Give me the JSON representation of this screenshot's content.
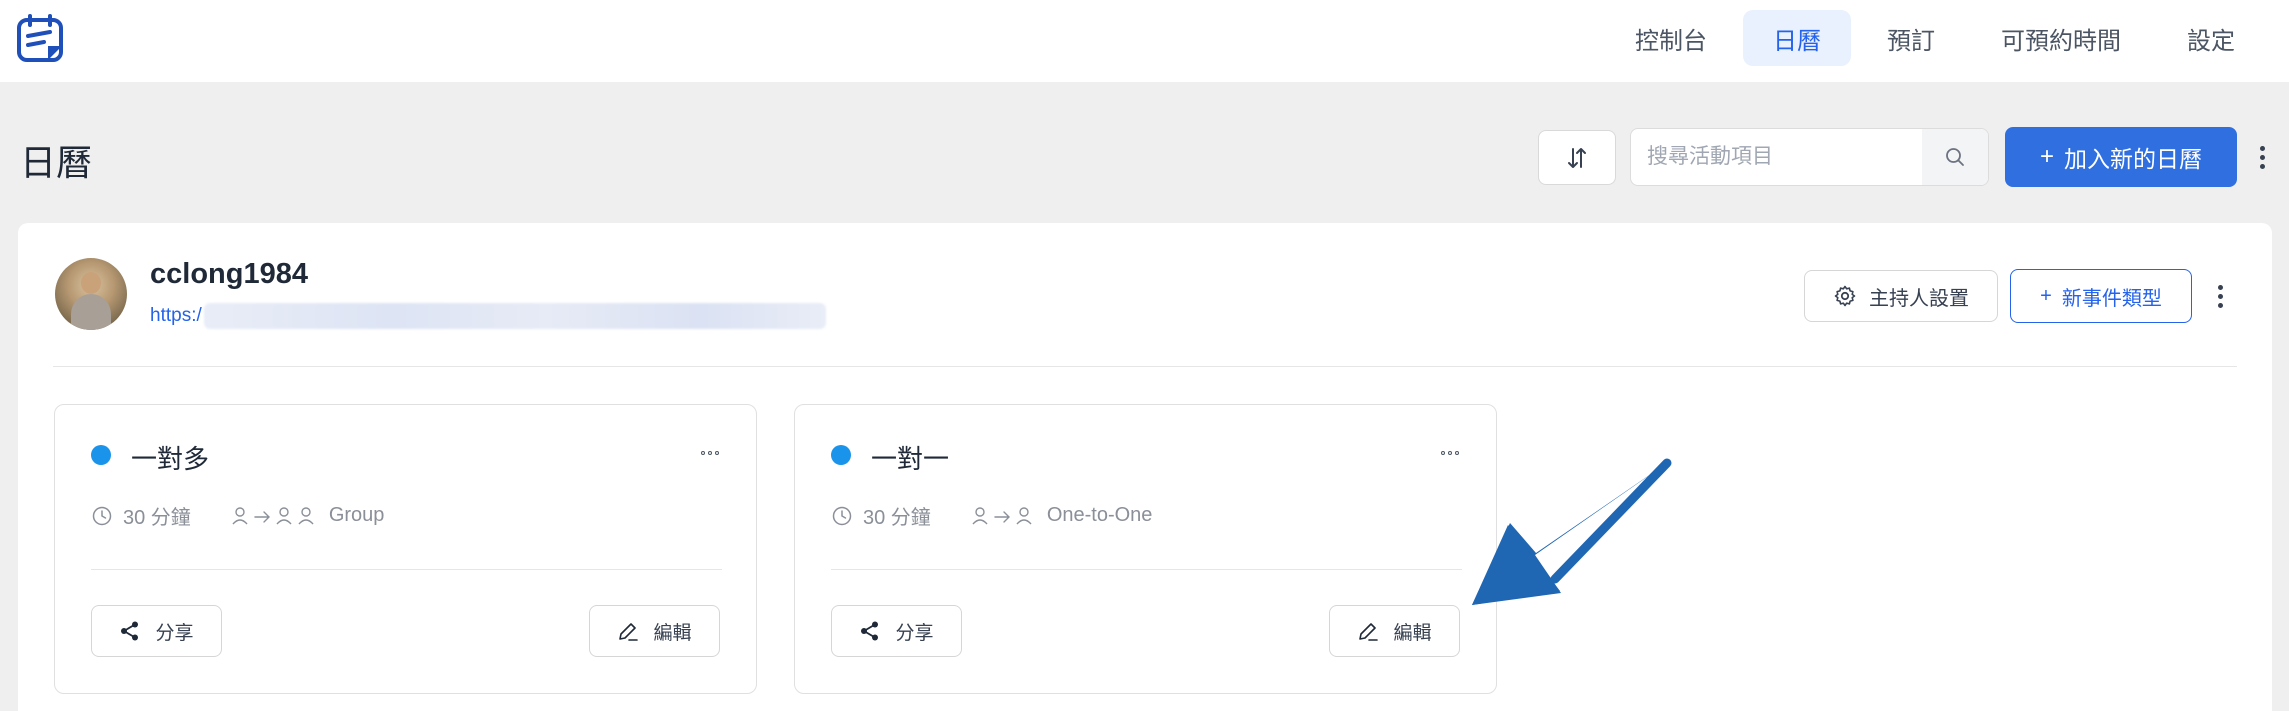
{
  "nav": {
    "items": [
      "控制台",
      "日曆",
      "預訂",
      "可預約時間",
      "設定"
    ],
    "active": "日曆"
  },
  "header": {
    "title": "日曆",
    "search_placeholder": "搜尋活動項目",
    "add_calendar": "加入新的日曆"
  },
  "calendar": {
    "username": "cclong1984",
    "url_prefix": "https:/",
    "host_settings": "主持人設置",
    "new_event_type": "新事件類型"
  },
  "events": [
    {
      "title": "一對多",
      "duration": "30 分鐘",
      "type": "Group",
      "share": "分享",
      "edit": "編輯"
    },
    {
      "title": "一對一",
      "duration": "30 分鐘",
      "type": "One-to-One",
      "share": "分享",
      "edit": "編輯"
    }
  ],
  "colors": {
    "accent": "#2f6fe0",
    "active_nav_bg": "#e8f1fd",
    "status_dot": "#1a93ea",
    "annotation_arrow": "#1f66b3"
  },
  "icons": {
    "logo": "calendar-logo-icon",
    "sort": "sort-arrows-icon",
    "search": "search-icon",
    "settings": "gear-icon",
    "clock": "clock-icon",
    "share": "share-icon",
    "edit": "pen-icon",
    "annotation": "arrow-icon"
  }
}
